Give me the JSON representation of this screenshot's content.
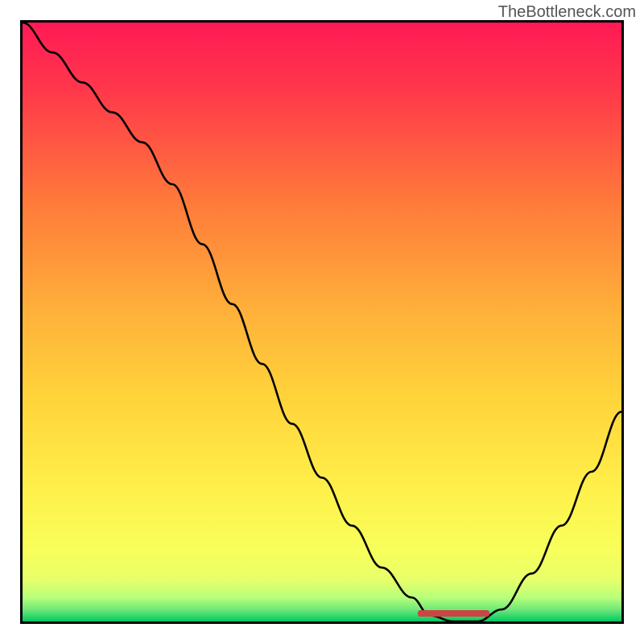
{
  "watermark": "TheBottleneck.com",
  "chart_data": {
    "type": "line",
    "title": "",
    "xlabel": "",
    "ylabel": "",
    "x": [
      0,
      5,
      10,
      15,
      20,
      25,
      30,
      35,
      40,
      45,
      50,
      55,
      60,
      65,
      68,
      72,
      76,
      80,
      85,
      90,
      95,
      100
    ],
    "values": [
      100,
      95,
      90,
      85,
      80,
      73,
      63,
      53,
      43,
      33,
      24,
      16,
      9,
      4,
      1,
      0,
      0,
      2,
      8,
      16,
      25,
      35
    ],
    "ylim": [
      0,
      100
    ],
    "xlim": [
      0,
      100
    ],
    "gradient_colors": {
      "top": "#ff1a4a",
      "upper_mid": "#ff7a3a",
      "mid": "#ffd23a",
      "lower_mid": "#f8ff5a",
      "near_bottom": "#d8ff7a",
      "bottom": "#00d060"
    },
    "optimal_marker": {
      "x_start": 66,
      "x_end": 78,
      "y": 0
    }
  }
}
